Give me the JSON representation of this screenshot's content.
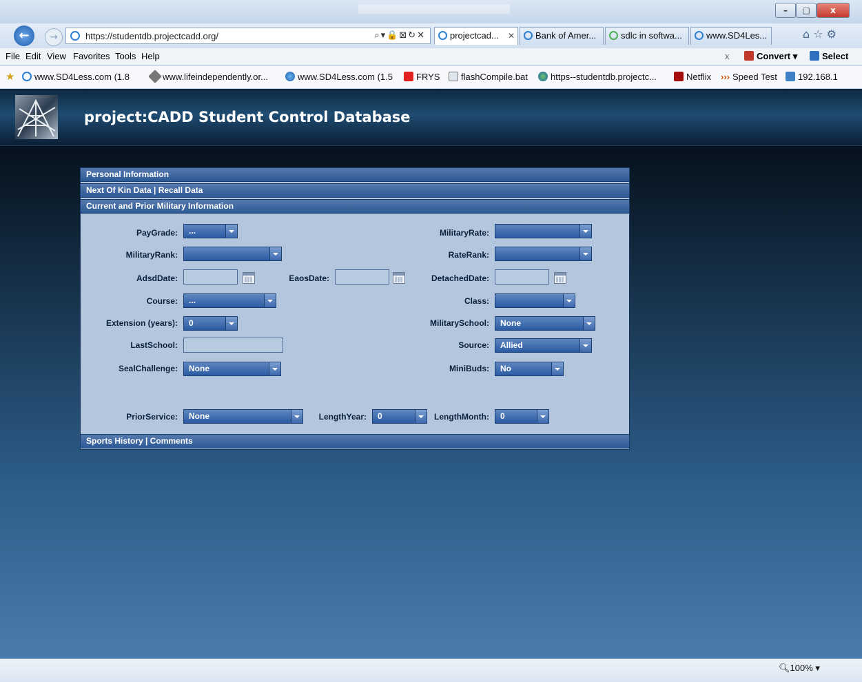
{
  "window": {
    "title_ghost": "",
    "buttons": {
      "minimize": "–",
      "maximize": "□",
      "close": "x"
    }
  },
  "navigation": {
    "address": "https://studentdb.projectcadd.org/",
    "address_controls": "⌕▾🔒⊠↻✕"
  },
  "tabs": [
    {
      "label": "projectcad...",
      "active": true
    },
    {
      "label": "Bank of Amer...",
      "active": false
    },
    {
      "label": "sdlc in softwa...",
      "active": false
    },
    {
      "label": "www.SD4Les...",
      "active": false
    }
  ],
  "menu": [
    "File",
    "Edit",
    "View",
    "Favorites",
    "Tools",
    "Help"
  ],
  "toolbar_right": {
    "close": "x",
    "convert": "Convert",
    "select": "Select"
  },
  "favorites": [
    "www.SD4Less.com (1.8",
    "www.lifeindependently.or...",
    "www.SD4Less.com (1.5",
    "FRYS",
    "flashCompile.bat",
    "https--studentdb.projectc...",
    "Netflix",
    "Speed Test",
    "192.168.1"
  ],
  "site": {
    "title": "project:CADD Student Control Database"
  },
  "sections": {
    "personal": "Personal Information",
    "nextofkin": "Next Of Kin Data | Recall Data",
    "military": "Current and Prior Military Information",
    "sports": "Sports History | Comments"
  },
  "form": {
    "paygrade": {
      "label": "PayGrade:",
      "value": "..."
    },
    "militaryrank": {
      "label": "MilitaryRank:",
      "value": ""
    },
    "adsddate": {
      "label": "AdsdDate:",
      "value": ""
    },
    "eaosdate": {
      "label": "EaosDate:",
      "value": ""
    },
    "course": {
      "label": "Course:",
      "value": "..."
    },
    "extension": {
      "label": "Extension (years):",
      "value": "0"
    },
    "lastschool": {
      "label": "LastSchool:",
      "value": ""
    },
    "sealchallenge": {
      "label": "SealChallenge:",
      "value": "None"
    },
    "militaryrate": {
      "label": "MilitaryRate:",
      "value": ""
    },
    "raterank": {
      "label": "RateRank:",
      "value": ""
    },
    "detacheddate": {
      "label": "DetachedDate:",
      "value": ""
    },
    "class": {
      "label": "Class:",
      "value": ""
    },
    "militaryschool": {
      "label": "MilitarySchool:",
      "value": "None"
    },
    "source": {
      "label": "Source:",
      "value": "Allied"
    },
    "minibuds": {
      "label": "MiniBuds:",
      "value": "No"
    },
    "priorservice": {
      "label": "PriorService:",
      "value": "None"
    },
    "lengthyear": {
      "label": "LengthYear:",
      "value": "0"
    },
    "lengthmonth": {
      "label": "LengthMonth:",
      "value": "0"
    }
  },
  "status": {
    "zoom": "100%"
  }
}
